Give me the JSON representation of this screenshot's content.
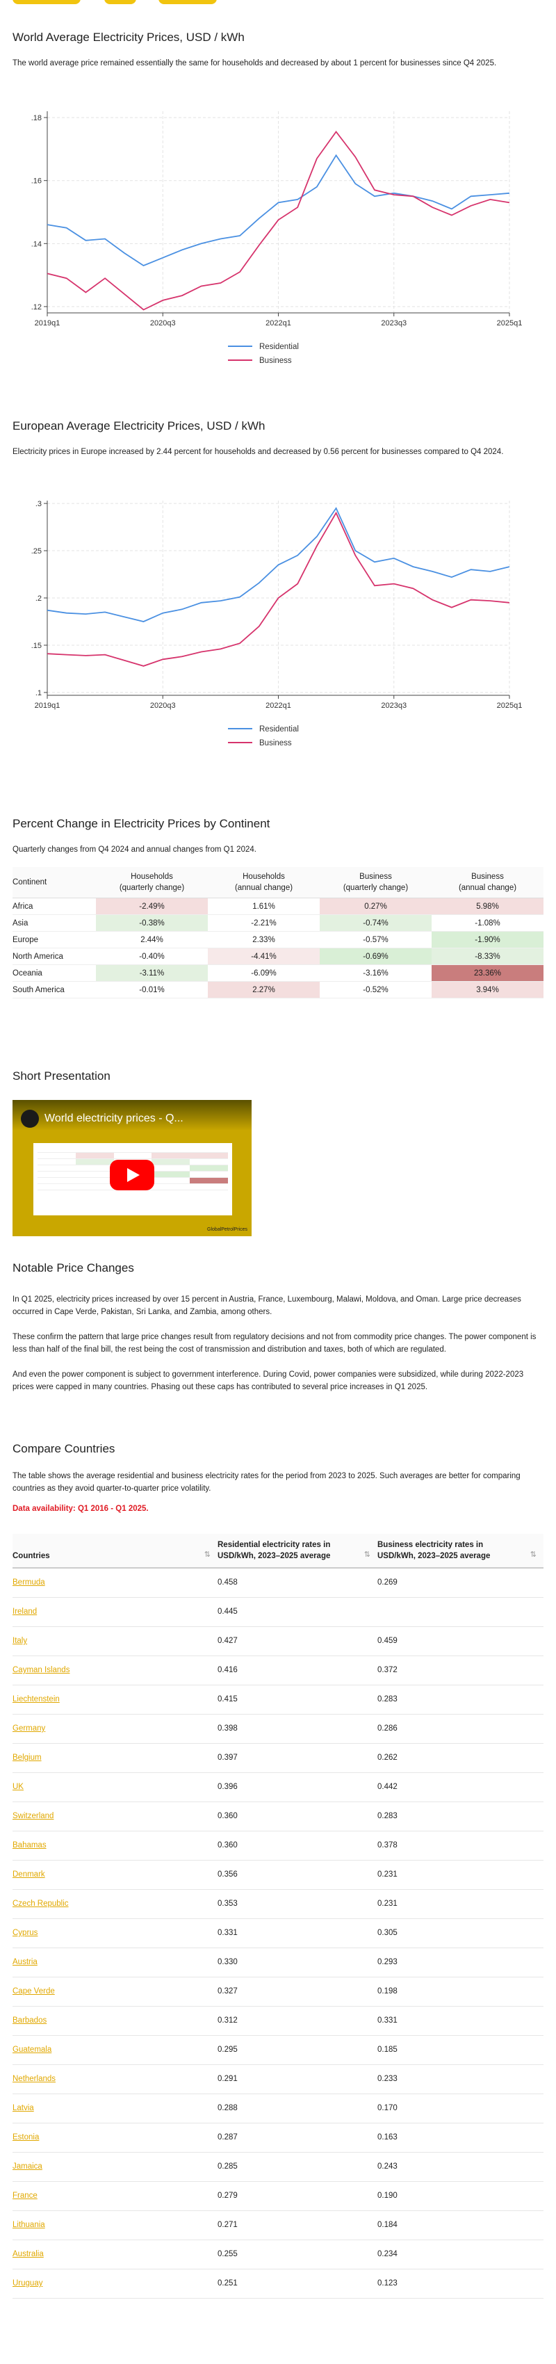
{
  "world_section": {
    "title": "World Average Electricity Prices, USD / kWh",
    "description": "The world average price remained essentially the same for households and decreased by about 1 percent for businesses since Q4 2025."
  },
  "europe_section": {
    "title": "European Average Electricity Prices, USD / kWh",
    "description": "Electricity prices in Europe increased by 2.44 percent for households and decreased by 0.56 percent for businesses compared to Q4 2024."
  },
  "chart_data": [
    {
      "type": "line",
      "x": [
        "2019q1",
        "2019q2",
        "2019q3",
        "2019q4",
        "2020q1",
        "2020q2",
        "2020q3",
        "2020q4",
        "2021q1",
        "2021q2",
        "2021q3",
        "2021q4",
        "2022q1",
        "2022q2",
        "2022q3",
        "2022q4",
        "2023q1",
        "2023q2",
        "2023q3",
        "2023q4",
        "2024q1",
        "2024q2",
        "2024q3",
        "2024q4",
        "2025q1"
      ],
      "xticks": [
        "2019q1",
        "2020q3",
        "2022q1",
        "2023q3",
        "2025q1"
      ],
      "yticks": [
        ".12",
        ".14",
        ".16",
        ".18"
      ],
      "ylim": [
        0.118,
        0.182
      ],
      "series": [
        {
          "name": "Residential",
          "color": "#4a90e2",
          "values": [
            0.146,
            0.145,
            0.141,
            0.1415,
            0.137,
            0.133,
            0.1355,
            0.138,
            0.14,
            0.1415,
            0.1425,
            0.148,
            0.153,
            0.154,
            0.158,
            0.168,
            0.159,
            0.155,
            0.156,
            0.155,
            0.1535,
            0.151,
            0.155,
            0.1555,
            0.156
          ]
        },
        {
          "name": "Business",
          "color": "#d6336c",
          "values": [
            0.1305,
            0.129,
            0.1245,
            0.129,
            0.124,
            0.119,
            0.122,
            0.1235,
            0.1265,
            0.1275,
            0.131,
            0.1395,
            0.1475,
            0.1515,
            0.167,
            0.1755,
            0.1675,
            0.157,
            0.1555,
            0.155,
            0.1515,
            0.149,
            0.152,
            0.154,
            0.153
          ]
        }
      ]
    },
    {
      "type": "line",
      "x": [
        "2019q1",
        "2019q2",
        "2019q3",
        "2019q4",
        "2020q1",
        "2020q2",
        "2020q3",
        "2020q4",
        "2021q1",
        "2021q2",
        "2021q3",
        "2021q4",
        "2022q1",
        "2022q2",
        "2022q3",
        "2022q4",
        "2023q1",
        "2023q2",
        "2023q3",
        "2023q4",
        "2024q1",
        "2024q2",
        "2024q3",
        "2024q4",
        "2025q1"
      ],
      "xticks": [
        "2019q1",
        "2020q3",
        "2022q1",
        "2023q3",
        "2025q1"
      ],
      "yticks": [
        ".1",
        ".15",
        ".2",
        ".25",
        ".3"
      ],
      "ylim": [
        0.097,
        0.303
      ],
      "series": [
        {
          "name": "Residential",
          "color": "#4a90e2",
          "values": [
            0.187,
            0.184,
            0.183,
            0.185,
            0.18,
            0.175,
            0.184,
            0.188,
            0.195,
            0.197,
            0.201,
            0.216,
            0.235,
            0.245,
            0.265,
            0.295,
            0.25,
            0.238,
            0.242,
            0.233,
            0.228,
            0.222,
            0.23,
            0.228,
            0.233
          ]
        },
        {
          "name": "Business",
          "color": "#d6336c",
          "values": [
            0.141,
            0.14,
            0.139,
            0.14,
            0.134,
            0.128,
            0.135,
            0.138,
            0.143,
            0.146,
            0.152,
            0.17,
            0.2,
            0.215,
            0.255,
            0.29,
            0.245,
            0.213,
            0.215,
            0.21,
            0.198,
            0.19,
            0.198,
            0.197,
            0.195
          ]
        }
      ]
    }
  ],
  "continent_section": {
    "title": "Percent Change in Electricity Prices by Continent",
    "description": "Quarterly changes from Q4 2024 and annual changes from Q1 2024.",
    "headers": [
      "Continent",
      "Households\n(quarterly change)",
      "Households\n(annual change)",
      "Business\n(quarterly change)",
      "Business\n(annual change)"
    ],
    "rows": [
      {
        "cells": [
          "Africa",
          "-2.49%",
          "1.61%",
          "0.27%",
          "5.98%"
        ],
        "colors": [
          "",
          "#f4dede",
          "",
          "#f4dede",
          "#f4dede"
        ]
      },
      {
        "cells": [
          "Asia",
          "-0.38%",
          "-2.21%",
          "-0.74%",
          "-1.08%"
        ],
        "colors": [
          "",
          "#e3f1e0",
          "",
          "#e3f1e0",
          ""
        ]
      },
      {
        "cells": [
          "Europe",
          "2.44%",
          "2.33%",
          "-0.57%",
          "-1.90%"
        ],
        "colors": [
          "",
          "",
          "",
          "",
          "#d9efd6"
        ]
      },
      {
        "cells": [
          "North America",
          "-0.40%",
          "-4.41%",
          "-0.69%",
          "-8.33%"
        ],
        "colors": [
          "",
          "",
          "#f7e9e9",
          "#d9efd6",
          "#e3f1e0"
        ]
      },
      {
        "cells": [
          "Oceania",
          "-3.11%",
          "-6.09%",
          "-3.16%",
          "23.36%"
        ],
        "colors": [
          "",
          "#e3f1e0",
          "",
          "",
          "#c97d7d"
        ]
      },
      {
        "cells": [
          "South America",
          "-0.01%",
          "2.27%",
          "-0.52%",
          "3.94%"
        ],
        "colors": [
          "",
          "",
          "#f4dede",
          "",
          "#f4dede"
        ]
      }
    ]
  },
  "presentation_section": {
    "title": "Short Presentation",
    "video_title": "World electricity prices - Q...",
    "brand_text": "GlobalPetrolPrices"
  },
  "notable_section": {
    "title": "Notable Price Changes",
    "paragraphs": [
      "In Q1 2025, electricity prices increased by over 15 percent in Austria, France, Luxembourg, Malawi, Moldova, and Oman. Large price decreases occurred in Cape Verde, Pakistan, Sri Lanka, and Zambia, among others.",
      "These confirm the pattern that large price changes result from regulatory decisions and not from commodity price changes. The power component is less than half of the final bill, the rest being the cost of transmission and distribution and taxes, both of which are regulated.",
      "And even the power component is subject to government interference. During Covid, power companies were subsidized, while during 2022-2023 prices were capped in many countries. Phasing out these caps has contributed to several price increases in Q1 2025."
    ]
  },
  "compare_section": {
    "title": "Compare Countries",
    "description": "The table shows the average residential and business electricity rates for the period from 2023 to 2025. Such averages are better for comparing countries as they avoid quarter-to-quarter price volatility.",
    "availability": "Data availability: Q1 2016 - Q1 2025.",
    "headers": [
      "Countries",
      "Residential electricity rates in USD/kWh, 2023–2025 average",
      "Business electricity rates in USD/kWh, 2023–2025 average"
    ],
    "sort_icon": "⇅",
    "rows": [
      [
        "Bermuda",
        "0.458",
        "0.269"
      ],
      [
        "Ireland",
        "0.445",
        ""
      ],
      [
        "Italy",
        "0.427",
        "0.459"
      ],
      [
        "Cayman Islands",
        "0.416",
        "0.372"
      ],
      [
        "Liechtenstein",
        "0.415",
        "0.283"
      ],
      [
        "Germany",
        "0.398",
        "0.286"
      ],
      [
        "Belgium",
        "0.397",
        "0.262"
      ],
      [
        "UK",
        "0.396",
        "0.442"
      ],
      [
        "Switzerland",
        "0.360",
        "0.283"
      ],
      [
        "Bahamas",
        "0.360",
        "0.378"
      ],
      [
        "Denmark",
        "0.356",
        "0.231"
      ],
      [
        "Czech Republic",
        "0.353",
        "0.231"
      ],
      [
        "Cyprus",
        "0.331",
        "0.305"
      ],
      [
        "Austria",
        "0.330",
        "0.293"
      ],
      [
        "Cape Verde",
        "0.327",
        "0.198"
      ],
      [
        "Barbados",
        "0.312",
        "0.331"
      ],
      [
        "Guatemala",
        "0.295",
        "0.185"
      ],
      [
        "Netherlands",
        "0.291",
        "0.233"
      ],
      [
        "Latvia",
        "0.288",
        "0.170"
      ],
      [
        "Estonia",
        "0.287",
        "0.163"
      ],
      [
        "Jamaica",
        "0.285",
        "0.243"
      ],
      [
        "France",
        "0.279",
        "0.190"
      ],
      [
        "Lithuania",
        "0.271",
        "0.184"
      ],
      [
        "Australia",
        "0.255",
        "0.234"
      ],
      [
        "Uruguay",
        "0.251",
        "0.123"
      ]
    ]
  }
}
